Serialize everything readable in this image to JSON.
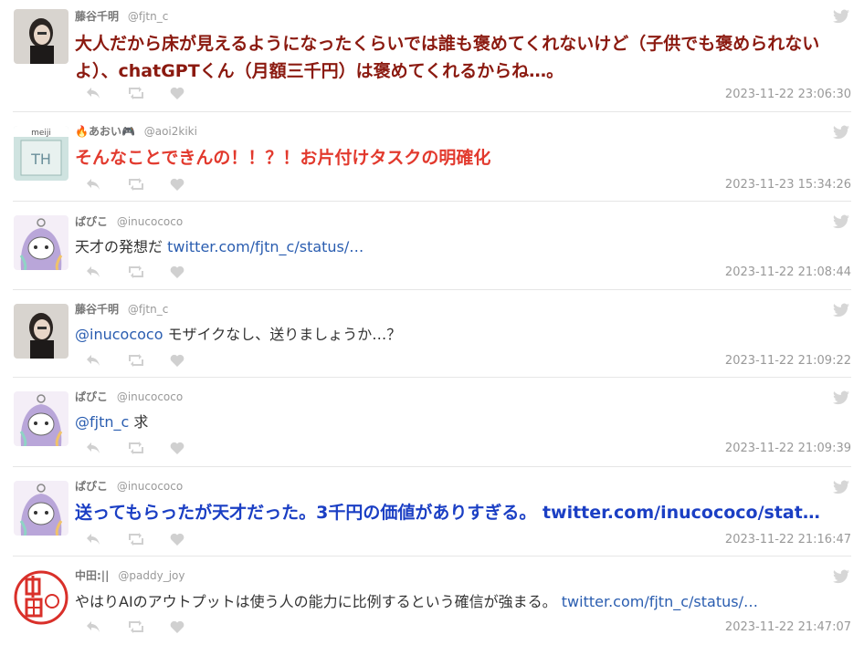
{
  "tweets": [
    {
      "name": "藤谷千明",
      "handle": "@fjtn_c",
      "text": "大人だから床が見えるようになったくらいでは誰も褒めてくれないけど（子供でも褒められないよ）、chatGPTくん（月額三千円）は褒めてくれるからね…。",
      "link": "",
      "style": "big",
      "color": "#8b1a10",
      "time": "2023-11-22 23:06:30"
    },
    {
      "name": "🔥あおい🎮",
      "handle": "@aoi2kiki",
      "text": "そんなことできんの！！？！お片付けタスクの明確化",
      "link": "",
      "style": "big",
      "color": "#e23a2e",
      "time": "2023-11-23 15:34:26"
    },
    {
      "name": "ぱぴこ",
      "handle": "@inucococo",
      "text": "天才の発想だ ",
      "link": "twitter.com/fjtn_c/status/…",
      "style": "normal",
      "color": "#333333",
      "time": "2023-11-22 21:08:44"
    },
    {
      "name": "藤谷千明",
      "handle": "@fjtn_c",
      "mention": "@inucococo",
      "text": " モザイクなし、送りましょうか…？",
      "link": "",
      "style": "normal",
      "color": "#333333",
      "time": "2023-11-22 21:09:22"
    },
    {
      "name": "ぱぴこ",
      "handle": "@inucococo",
      "mention": "@fjtn_c",
      "text": " 求",
      "link": "",
      "style": "normal",
      "color": "#333333",
      "time": "2023-11-22 21:09:39"
    },
    {
      "name": "ぱぴこ",
      "handle": "@inucococo",
      "text": "送ってもらったが天才だった。3千円の価値がありすぎる。 ",
      "link": "twitter.com/inucococo/stat…",
      "style": "big",
      "color": "#1b3fc4",
      "time": "2023-11-22 21:16:47"
    },
    {
      "name": "中田:||",
      "handle": "@paddy_joy",
      "text": "やはりAIのアウトプットは使う人の能力に比例するという確信が強まる。 ",
      "link": "twitter.com/fjtn_c/status/…",
      "style": "normal",
      "color": "#333333",
      "time": "2023-11-22 21:47:07"
    }
  ],
  "colors": {
    "link": "#2a5db0",
    "icon": "#d0d0d0",
    "separator": "#e6e6e6"
  },
  "icons": {
    "reply": "reply-icon",
    "retweet": "retweet-icon",
    "like": "heart-icon",
    "service": "twitter-bird-icon"
  }
}
